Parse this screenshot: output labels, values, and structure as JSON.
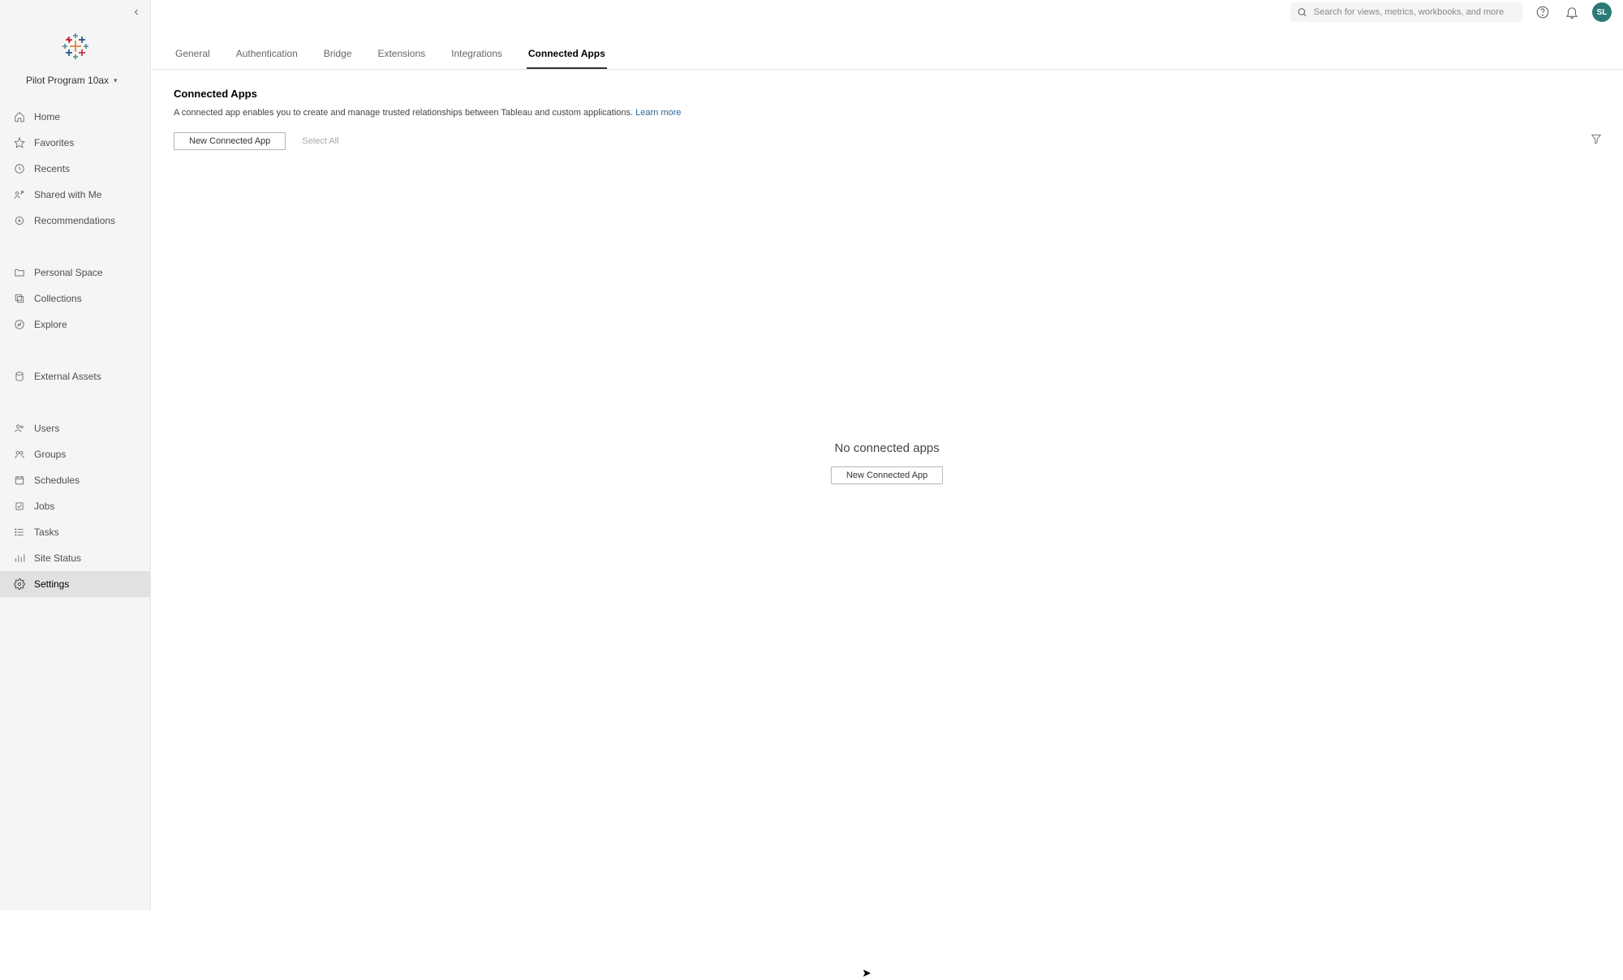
{
  "site": {
    "name": "Pilot Program 10ax"
  },
  "header": {
    "search_placeholder": "Search for views, metrics, workbooks, and more",
    "avatar_initials": "SL"
  },
  "sidebar": {
    "items": [
      {
        "id": "home",
        "label": "Home",
        "icon": "home-icon"
      },
      {
        "id": "favorites",
        "label": "Favorites",
        "icon": "star-icon"
      },
      {
        "id": "recents",
        "label": "Recents",
        "icon": "clock-icon"
      },
      {
        "id": "shared-with-me",
        "label": "Shared with Me",
        "icon": "share-icon"
      },
      {
        "id": "recommendations",
        "label": "Recommendations",
        "icon": "sparkle-icon"
      }
    ],
    "items2": [
      {
        "id": "personal-space",
        "label": "Personal Space",
        "icon": "folder-person-icon"
      },
      {
        "id": "collections",
        "label": "Collections",
        "icon": "stack-icon"
      },
      {
        "id": "explore",
        "label": "Explore",
        "icon": "compass-icon"
      }
    ],
    "items3": [
      {
        "id": "external-assets",
        "label": "External Assets",
        "icon": "external-icon"
      }
    ],
    "items4": [
      {
        "id": "users",
        "label": "Users",
        "icon": "users-icon"
      },
      {
        "id": "groups",
        "label": "Groups",
        "icon": "groups-icon"
      },
      {
        "id": "schedules",
        "label": "Schedules",
        "icon": "calendar-icon"
      },
      {
        "id": "jobs",
        "label": "Jobs",
        "icon": "jobs-icon"
      },
      {
        "id": "tasks",
        "label": "Tasks",
        "icon": "tasks-icon"
      },
      {
        "id": "site-status",
        "label": "Site Status",
        "icon": "chart-icon"
      },
      {
        "id": "settings",
        "label": "Settings",
        "icon": "gear-icon",
        "active": true
      }
    ]
  },
  "tabs": [
    {
      "id": "general",
      "label": "General"
    },
    {
      "id": "authentication",
      "label": "Authentication"
    },
    {
      "id": "bridge",
      "label": "Bridge"
    },
    {
      "id": "extensions",
      "label": "Extensions"
    },
    {
      "id": "integrations",
      "label": "Integrations"
    },
    {
      "id": "connected-apps",
      "label": "Connected Apps",
      "active": true
    }
  ],
  "panel": {
    "title": "Connected Apps",
    "description": "A connected app enables you to create and manage trusted relationships between Tableau and custom applications.",
    "learn_more": "Learn more",
    "new_button": "New Connected App",
    "select_all": "Select All"
  },
  "empty": {
    "title": "No connected apps",
    "button": "New Connected App"
  }
}
